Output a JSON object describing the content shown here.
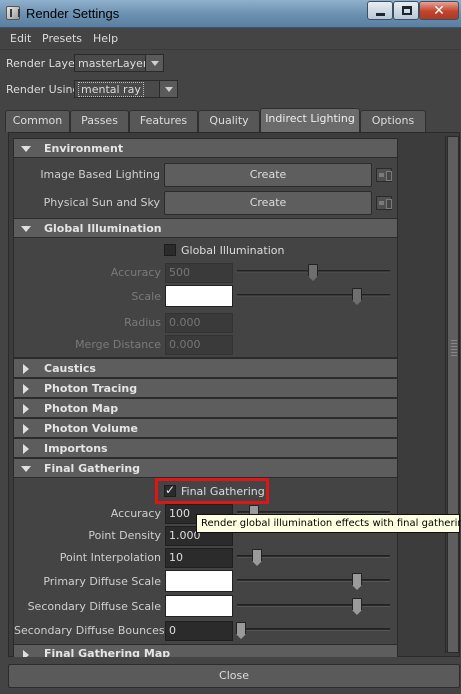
{
  "window": {
    "title": "Render Settings"
  },
  "menu": {
    "items": [
      "Edit",
      "Presets",
      "Help"
    ]
  },
  "render_layer": {
    "label": "Render Layer",
    "value": "masterLayer"
  },
  "render_using": {
    "label": "Render Using",
    "value": "mental ray"
  },
  "tabs": [
    "Common",
    "Passes",
    "Features",
    "Quality",
    "Indirect Lighting",
    "Options"
  ],
  "active_tab": "Indirect Lighting",
  "environment": {
    "header": "Environment",
    "ibl_label": "Image Based Lighting",
    "ibl_button": "Create",
    "sun_label": "Physical Sun and Sky",
    "sun_button": "Create"
  },
  "gi": {
    "header": "Global Illumination",
    "checkbox_label": "Global Illumination",
    "checked": false,
    "accuracy_label": "Accuracy",
    "accuracy_value": "500",
    "scale_label": "Scale",
    "radius_label": "Radius",
    "radius_value": "0.000",
    "merge_label": "Merge Distance",
    "merge_value": "0.000"
  },
  "collapsed_sections": [
    "Caustics",
    "Photon Tracing",
    "Photon Map",
    "Photon Volume",
    "Importons"
  ],
  "fg": {
    "header": "Final Gathering",
    "checkbox_label": "Final Gathering",
    "checked": true,
    "accuracy_label": "Accuracy",
    "accuracy_value": "100",
    "point_density_label": "Point Density",
    "point_density_value": "1.000",
    "point_interp_label": "Point Interpolation",
    "point_interp_value": "10",
    "primary_diffuse_label": "Primary Diffuse Scale",
    "secondary_diffuse_label": "Secondary Diffuse Scale",
    "secondary_bounces_label": "Secondary Diffuse Bounces",
    "secondary_bounces_value": "0"
  },
  "next_section": "Final Gathering Map",
  "tooltip": "Render global illumination effects with final gathering.",
  "close_button": "Close"
}
